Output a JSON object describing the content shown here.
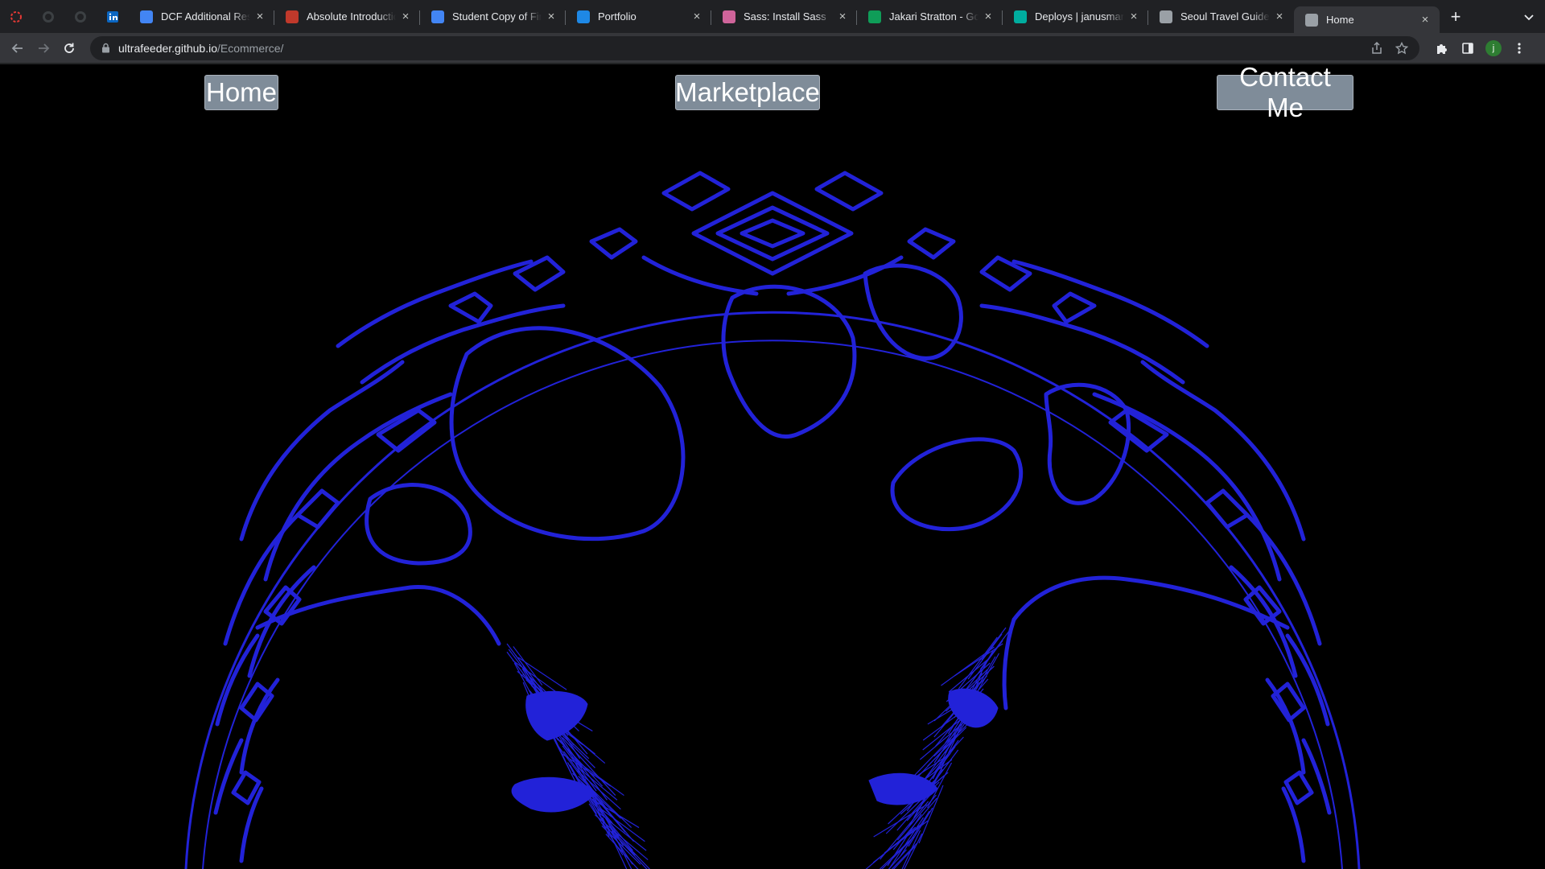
{
  "browser": {
    "tabs": [
      {
        "title": "DCF Additional Resources",
        "icon": "docs-icon",
        "color": "#4285f4"
      },
      {
        "title": "Absolute Introduction",
        "icon": "book-icon",
        "color": "#c0392b"
      },
      {
        "title": "Student Copy of Final",
        "icon": "docs-icon",
        "color": "#4285f4"
      },
      {
        "title": "Portfolio",
        "icon": "jp-icon",
        "color": "#1e88e5"
      },
      {
        "title": "Sass: Install Sass",
        "icon": "sass-icon",
        "color": "#cf649a"
      },
      {
        "title": "Jakari Stratton - Google",
        "icon": "sheets-icon",
        "color": "#0f9d58"
      },
      {
        "title": "Deploys | janusmark",
        "icon": "netlify-icon",
        "color": "#00ad9f"
      },
      {
        "title": "Seoul Travel Guide",
        "icon": "globe-icon",
        "color": "#9aa0a6"
      },
      {
        "title": "Home",
        "icon": "globe-icon",
        "color": "#9aa0a6",
        "active": true
      }
    ],
    "url_host": "ultrafeeder.github.io",
    "url_path": "/Ecommerce/",
    "profile_initial": "j"
  },
  "page": {
    "nav": {
      "home_label": "Home",
      "marketplace_label": "Marketplace",
      "contact_label": "Contact Me"
    },
    "art": {
      "name": "celtic-tree-of-life-art",
      "stroke_color": "#2222d8"
    }
  }
}
